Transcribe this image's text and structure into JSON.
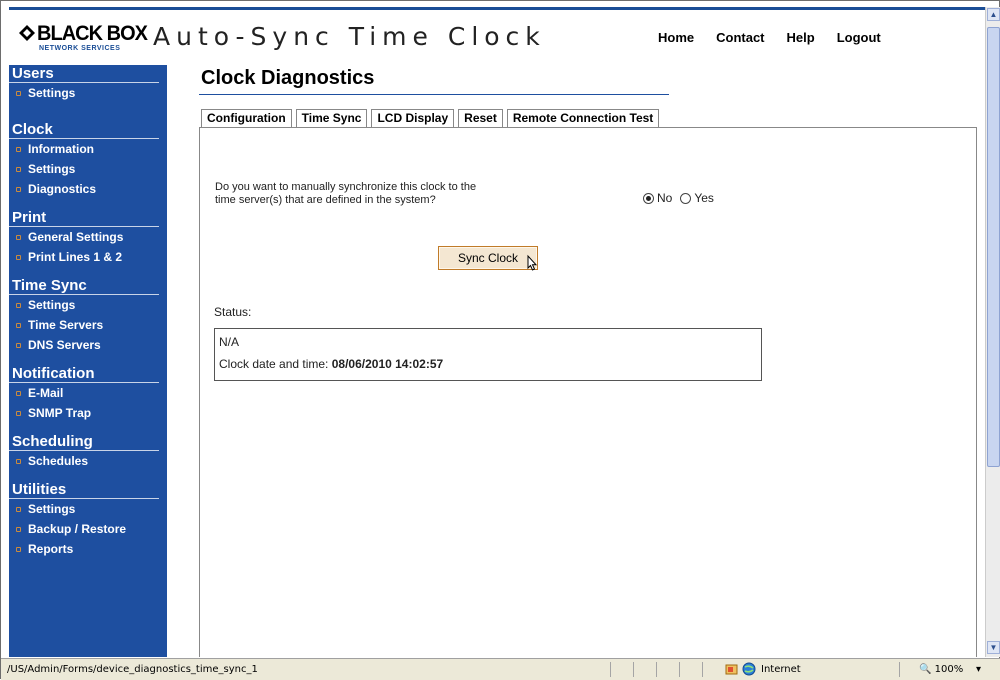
{
  "header": {
    "brand": "BLACK BOX",
    "brand_sub": "NETWORK SERVICES",
    "app_title": "Auto-Sync Time Clock",
    "nav": [
      "Home",
      "Contact",
      "Help",
      "Logout"
    ]
  },
  "sidebar": {
    "sections": [
      {
        "title": "Users",
        "items": [
          "Settings"
        ]
      },
      {
        "title": "Clock",
        "items": [
          "Information",
          "Settings",
          "Diagnostics"
        ]
      },
      {
        "title": "Print",
        "items": [
          "General Settings",
          "Print Lines 1 & 2"
        ]
      },
      {
        "title": "Time Sync",
        "items": [
          "Settings",
          "Time Servers",
          "DNS Servers"
        ]
      },
      {
        "title": "Notification",
        "items": [
          "E-Mail",
          "SNMP Trap"
        ]
      },
      {
        "title": "Scheduling",
        "items": [
          "Schedules"
        ]
      },
      {
        "title": "Utilities",
        "items": [
          "Settings",
          "Backup / Restore",
          "Reports"
        ]
      }
    ]
  },
  "main": {
    "page_title": "Clock Diagnostics",
    "tabs": [
      {
        "label": "Configuration",
        "active": false
      },
      {
        "label": "Time Sync",
        "active": true
      },
      {
        "label": "LCD Display",
        "active": false
      },
      {
        "label": "Reset",
        "active": false
      },
      {
        "label": "Remote Connection Test",
        "active": false
      }
    ],
    "question_line1": "Do you want to manually synchronize this clock to the",
    "question_line2": "time server(s) that are defined in the system?",
    "radio_no": "No",
    "radio_yes": "Yes",
    "radio_selected": "No",
    "sync_button": "Sync Clock",
    "status_label": "Status:",
    "status_value": "N/A",
    "clock_label": "Clock date and time:",
    "clock_value": "08/06/2010 14:02:57"
  },
  "statusbar": {
    "path": "/US/Admin/Forms/device_diagnostics_time_sync_1",
    "zone": "Internet",
    "zoom": "100%"
  },
  "colors": {
    "sidebar_bg": "#1e4fa0",
    "accent": "#1a4d96",
    "button_bg": "#f4e7d2",
    "button_border": "#c07b29",
    "bullet": "#c98a3e"
  }
}
